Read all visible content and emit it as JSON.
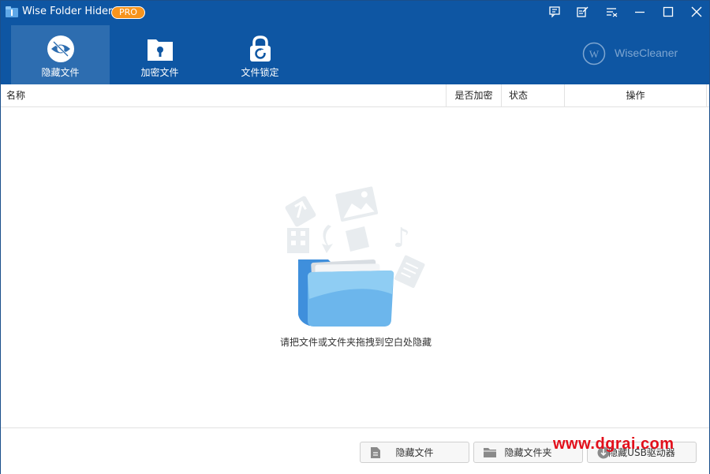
{
  "app": {
    "title": "Wise Folder Hider",
    "badge": "PRO"
  },
  "titlebar_icons": [
    "feedback-icon",
    "edit-note-icon",
    "settings-menu-icon",
    "minimize-icon",
    "maximize-icon",
    "close-icon"
  ],
  "nav": [
    {
      "label": "隐藏文件",
      "icon": "eye-hidden-icon",
      "active": true
    },
    {
      "label": "加密文件",
      "icon": "locked-folder-icon",
      "active": false
    },
    {
      "label": "文件锁定",
      "icon": "padlock-icon",
      "active": false
    }
  ],
  "brand": {
    "text": "WiseCleaner",
    "letter": "W"
  },
  "table": {
    "columns": [
      "名称",
      "是否加密",
      "状态",
      "操作"
    ]
  },
  "empty": {
    "hint": "请把文件或文件夹拖拽到空白处隐藏"
  },
  "buttons": [
    {
      "label": "隐藏文件",
      "icon": "file-icon"
    },
    {
      "label": "隐藏文件夹",
      "icon": "folder-icon"
    },
    {
      "label": "隐藏USB驱动器",
      "icon": "usb-drive-icon"
    }
  ],
  "watermark": "www.dgrai.com",
  "colors": {
    "header": "#0e56a3",
    "nav_active": "#2d6db0",
    "pro_badge": "#f7941d",
    "watermark": "#e30f1b"
  }
}
